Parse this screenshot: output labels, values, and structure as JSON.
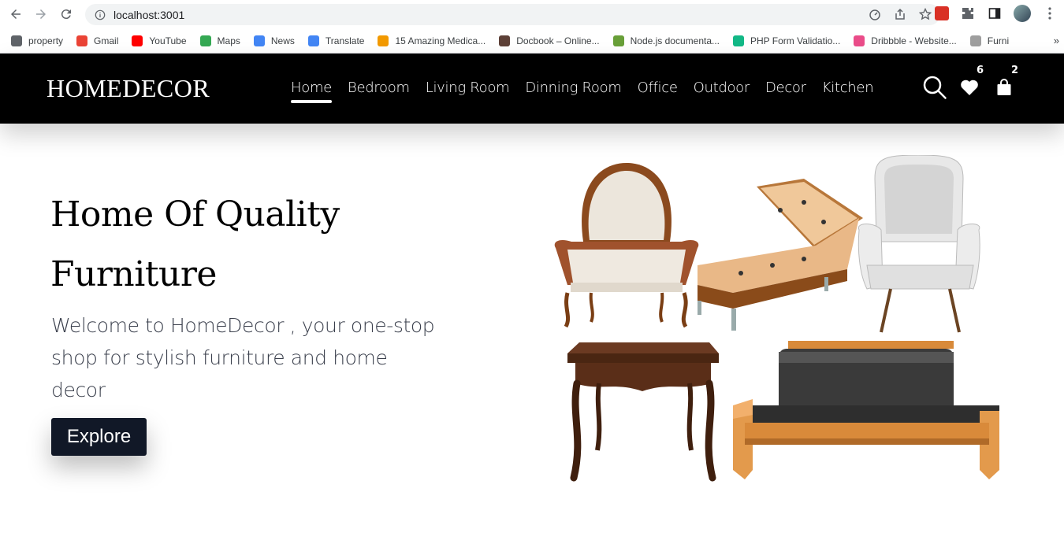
{
  "browser": {
    "url": "localhost:3001",
    "bookmarks": [
      {
        "label": "property",
        "icon": "globe-icon",
        "color": "#5f6368"
      },
      {
        "label": "Gmail",
        "icon": "gmail-icon",
        "color": "#ea4335"
      },
      {
        "label": "YouTube",
        "icon": "youtube-icon",
        "color": "#ff0000"
      },
      {
        "label": "Maps",
        "icon": "maps-icon",
        "color": "#34a853"
      },
      {
        "label": "News",
        "icon": "news-icon",
        "color": "#4285f4"
      },
      {
        "label": "Translate",
        "icon": "translate-icon",
        "color": "#4285f4"
      },
      {
        "label": "15 Amazing Medica...",
        "icon": "figure-icon",
        "color": "#f29900"
      },
      {
        "label": "Docbook – Online...",
        "icon": "docbook-icon",
        "color": "#5d4037"
      },
      {
        "label": "Node.js documenta...",
        "icon": "nodejs-icon",
        "color": "#689f38"
      },
      {
        "label": "PHP Form Validatio...",
        "icon": "php-icon",
        "color": "#12b886"
      },
      {
        "label": "Dribbble - Website...",
        "icon": "dribbble-icon",
        "color": "#ea4c89"
      },
      {
        "label": "Furni",
        "icon": "furni-icon",
        "color": "#9e9e9e"
      }
    ],
    "more": "»"
  },
  "site": {
    "logo": "HOMEDECOR",
    "menu": [
      {
        "label": "Home",
        "active": true
      },
      {
        "label": "Bedroom"
      },
      {
        "label": "Living Room"
      },
      {
        "label": "Dinning Room"
      },
      {
        "label": "Office"
      },
      {
        "label": "Outdoor"
      },
      {
        "label": "Decor"
      },
      {
        "label": "Kitchen"
      }
    ],
    "wishlist_count": "6",
    "cart_count": "2"
  },
  "hero": {
    "title_line1": "Home Of Quality",
    "title_line2": "Furniture",
    "subtitle": "Welcome to HomeDecor , your one-stop shop for stylish furniture and home decor",
    "button": "Explore"
  },
  "colors": {
    "nav_bg": "#000000",
    "button_bg": "#111827",
    "subtitle": "#3a3f4c"
  }
}
